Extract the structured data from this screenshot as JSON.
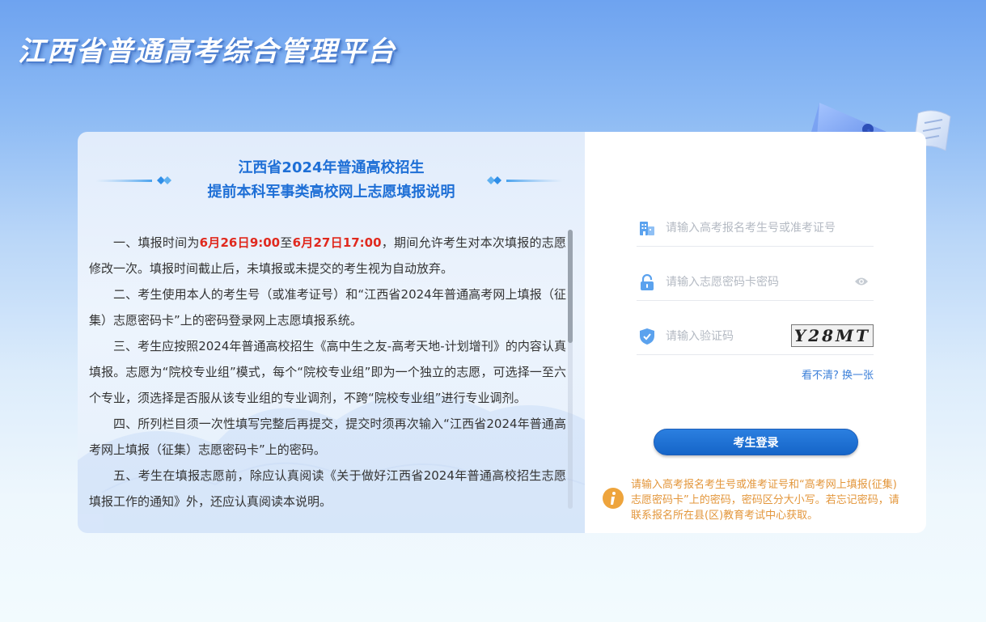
{
  "header": {
    "title": "江西省普通高考综合管理平台"
  },
  "notice": {
    "title_line1": "江西省2024年普通高校招生",
    "title_line2": "提前本科军事类高校网上志愿填报说明",
    "p1_before": "一、填报时间为",
    "p1_date1": "6月26日9:00",
    "p1_mid": "至",
    "p1_date2": "6月27日17:00",
    "p1_after": "，期间允许考生对本次填报的志愿修改一次。填报时间截止后，未填报或未提交的考生视为自动放弃。",
    "p2": "二、考生使用本人的考生号（或准考证号）和“江西省2024年普通高考网上填报（征集）志愿密码卡”上的密码登录网上志愿填报系统。",
    "p3": "三、考生应按照2024年普通高校招生《高中生之友-高考天地-计划增刊》的内容认真填报。志愿为“院校专业组”模式，每个“院校专业组”即为一个独立的志愿，可选择一至六个专业，须选择是否服从该专业组的专业调剂，不跨“院校专业组”进行专业调剂。",
    "p4": "四、所列栏目须一次性填写完整后再提交，提交时须再次输入“江西省2024年普通高考网上填报（征集）志愿密码卡”上的密码。",
    "p5": "五、考生在填报志愿前，除应认真阅读《关于做好江西省2024年普通高校招生志愿填报工作的通知》外，还应认真阅读本说明。"
  },
  "login": {
    "exam_id_placeholder": "请输入高考报名考生号或准考证号",
    "password_placeholder": "请输入志愿密码卡密码",
    "captcha_placeholder": "请输入验证码",
    "captcha_text": "Y28MT",
    "refresh_link": "看不清? 换一张",
    "submit_label": "考生登录",
    "tip": "请输入高考报名考生号或准考证号和“高考网上填报(征集)志愿密码卡”上的密码，密码区分大小写。若忘记密码，请联系报名所在县(区)教育考试中心获取。"
  },
  "colors": {
    "accent": "#1e6fd6",
    "highlight": "#e0291e",
    "tip": "#e3963b",
    "button": "#1565c8"
  },
  "icons": [
    "building-icon",
    "lock-icon",
    "eye-icon",
    "shield-check-icon",
    "info-icon",
    "graduation-cap-icon"
  ]
}
